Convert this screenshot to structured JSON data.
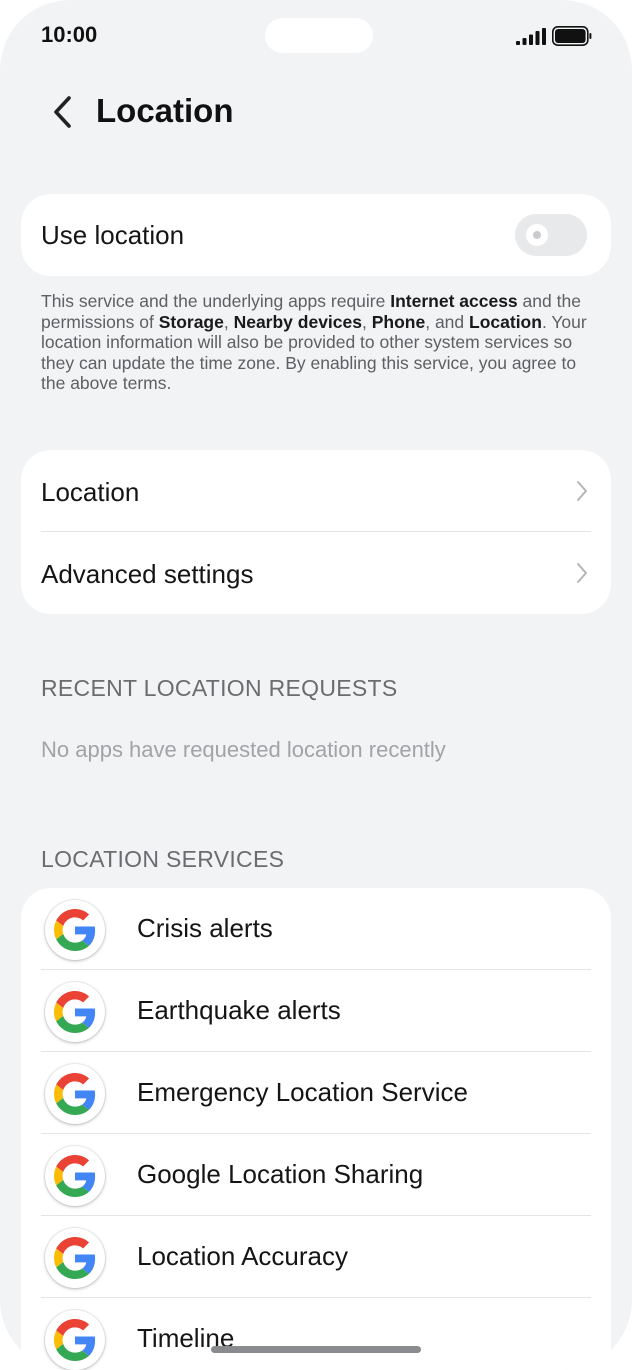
{
  "status_bar": {
    "time": "10:00"
  },
  "header": {
    "title": "Location"
  },
  "use_location": {
    "label": "Use location",
    "enabled": false
  },
  "description": {
    "p1": "This service and the underlying apps require ",
    "internet": "Internet access",
    "p2": " and the permissions of ",
    "storage": "Storage",
    "p3": ", ",
    "nearby": "Nearby devices",
    "p4": ", ",
    "phone": "Phone",
    "p5": ", and ",
    "location": "Location",
    "p6": ". Your location information will also be provided to other system services so they can update the time zone. By enabling this service, you agree to the above terms."
  },
  "settings": {
    "items": [
      {
        "label": "Location"
      },
      {
        "label": "Advanced settings"
      }
    ]
  },
  "recent": {
    "heading": "RECENT LOCATION REQUESTS",
    "empty_text": "No apps have requested location recently"
  },
  "services": {
    "heading": "LOCATION SERVICES",
    "items": [
      {
        "label": "Crisis alerts",
        "icon": "google-g-icon"
      },
      {
        "label": "Earthquake alerts",
        "icon": "google-g-icon"
      },
      {
        "label": "Emergency Location Service",
        "icon": "google-g-icon"
      },
      {
        "label": "Google Location Sharing",
        "icon": "google-g-icon"
      },
      {
        "label": "Location Accuracy",
        "icon": "google-g-icon"
      },
      {
        "label": "Timeline",
        "icon": "google-g-icon"
      }
    ]
  },
  "colors": {
    "background": "#f2f3f5",
    "card": "#ffffff",
    "toggle_off": "#e8e9eb"
  }
}
